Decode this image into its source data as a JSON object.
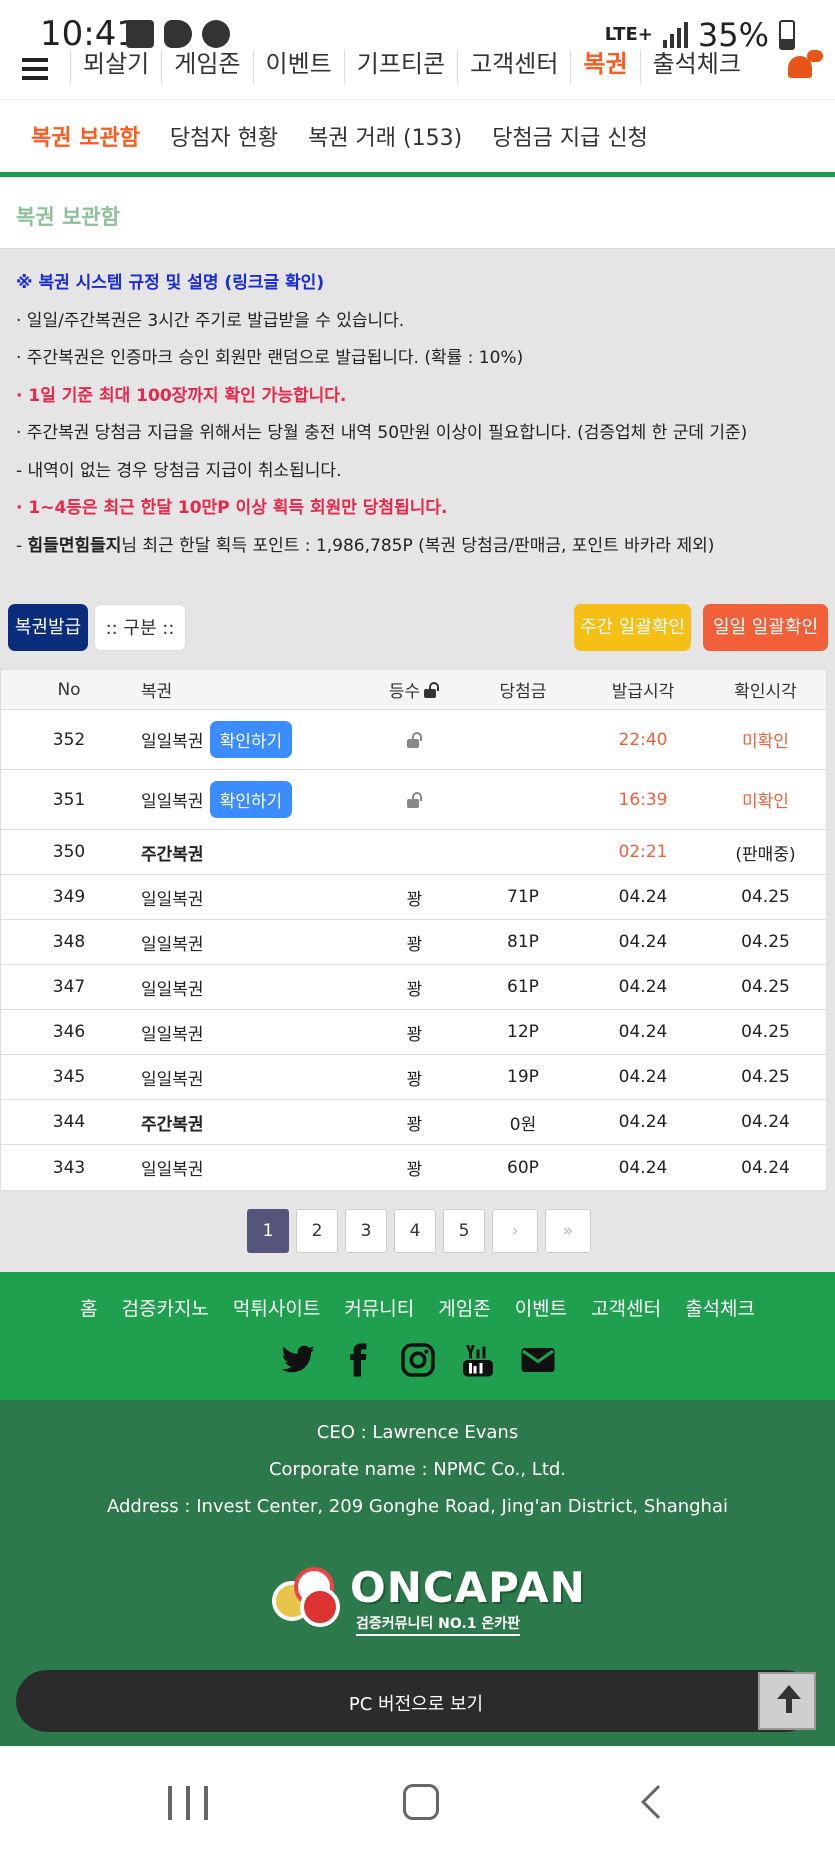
{
  "status_bar": {
    "time": "10:41",
    "network": "LTE+",
    "battery": "35%"
  },
  "top_nav": {
    "items": [
      {
        "label": "뫼살기",
        "active": false
      },
      {
        "label": "게임존",
        "active": false
      },
      {
        "label": "이벤트",
        "active": false
      },
      {
        "label": "기프티콘",
        "active": false
      },
      {
        "label": "고객센터",
        "active": false
      },
      {
        "label": "복권",
        "active": true
      },
      {
        "label": "출석체크",
        "active": false
      }
    ]
  },
  "sub_tabs": [
    {
      "label": "복권 보관함",
      "active": true
    },
    {
      "label": "당첨자 현황",
      "active": false
    },
    {
      "label": "복권 거래 (153)",
      "active": false
    },
    {
      "label": "당첨금 지급 신청",
      "active": false
    }
  ],
  "section": {
    "title": "복권 보관함"
  },
  "rules": {
    "heading": "※ 복권 시스템 규정 및 설명 (링크글 확인)",
    "line1": "· 일일/주간복권은 3시간 주기로 발급받을 수 있습니다.",
    "line2": "· 주간복권은 인증마크 승인 회원만 랜덤으로 발급됩니다. (확률 : 10%)",
    "line3": "· 1일 기준 최대 100장까지 확인 가능합니다.",
    "line4": "· 주간복권 당첨금 지급을 위해서는 당월 충전 내역 50만원 이상이 필요합니다. (검증업체 한 군데 기준)",
    "line5": " - 내역이 없는 경우 당첨금 지급이 취소됩니다.",
    "line6": "· 1~4등은 최근 한달 10만P 이상 획득 회원만 당첨됩니다.",
    "line7_prefix": " - ",
    "line7_user": "힘들면힘들지",
    "line7_rest": "님 최근 한달 획득 포인트 : 1,986,785P (복권 당첨금/판매금, 포인트 바카라 제외)"
  },
  "buttons": {
    "issue": "복권발급",
    "category": ":: 구분 ::",
    "weekly_check": "주간 일괄확인",
    "daily_check": "일일 일괄확인"
  },
  "table": {
    "headers": {
      "no": "No",
      "name": "복권",
      "grade": "등수",
      "prize": "당첨금",
      "issued": "발급시각",
      "checked": "확인시각"
    },
    "rows": [
      {
        "no": "352",
        "name": "일일복권",
        "button": "확인하기",
        "grade": "",
        "prize": "",
        "issued": "22:40",
        "checked": "미확인"
      },
      {
        "no": "351",
        "name": "일일복권",
        "button": "확인하기",
        "grade": "",
        "prize": "",
        "issued": "16:39",
        "checked": "미확인"
      },
      {
        "no": "350",
        "name": "주간복권",
        "button": "",
        "grade": "",
        "prize": "",
        "issued": "02:21",
        "checked": "(판매중)"
      },
      {
        "no": "349",
        "name": "일일복권",
        "button": "",
        "grade": "꽝",
        "prize": "71P",
        "issued": "04.24",
        "checked": "04.25"
      },
      {
        "no": "348",
        "name": "일일복권",
        "button": "",
        "grade": "꽝",
        "prize": "81P",
        "issued": "04.24",
        "checked": "04.25"
      },
      {
        "no": "347",
        "name": "일일복권",
        "button": "",
        "grade": "꽝",
        "prize": "61P",
        "issued": "04.24",
        "checked": "04.25"
      },
      {
        "no": "346",
        "name": "일일복권",
        "button": "",
        "grade": "꽝",
        "prize": "12P",
        "issued": "04.24",
        "checked": "04.25"
      },
      {
        "no": "345",
        "name": "일일복권",
        "button": "",
        "grade": "꽝",
        "prize": "19P",
        "issued": "04.24",
        "checked": "04.25"
      },
      {
        "no": "344",
        "name": "주간복권",
        "button": "",
        "grade": "꽝",
        "prize": "0원",
        "issued": "04.24",
        "checked": "04.24"
      },
      {
        "no": "343",
        "name": "일일복권",
        "button": "",
        "grade": "꽝",
        "prize": "60P",
        "issued": "04.24",
        "checked": "04.24"
      }
    ]
  },
  "pagination": {
    "pages": [
      "1",
      "2",
      "3",
      "4",
      "5"
    ],
    "current": "1",
    "next": "›",
    "last": "»"
  },
  "footer": {
    "links": [
      "홈",
      "검증카지노",
      "먹튀사이트",
      "커뮤니티",
      "게임존",
      "이벤트",
      "고객센터",
      "출석체크"
    ],
    "socials": [
      "twitter-icon",
      "facebook-icon",
      "instagram-icon",
      "youtube-icon",
      "mail-icon"
    ],
    "ceo": "CEO : Lawrence Evans",
    "corporate": "Corporate name : NPMC Co., Ltd.",
    "address": "Address : Invest Center, 209 Gonghe Road, Jing'an District, Shanghai",
    "logo_text": "ONCAPAN",
    "logo_sub": "검증커뮤니티 NO.1 온카판",
    "pc_version": "PC 버전으로 보기"
  },
  "colors": {
    "accent": "#ff5a1f",
    "green": "#1fa04f",
    "dark_green": "#2c7a4b",
    "navy": "#0b2c7a",
    "blue_button": "#3b8cff",
    "yellow": "#f6bf16",
    "orange_red": "#f2603a"
  }
}
